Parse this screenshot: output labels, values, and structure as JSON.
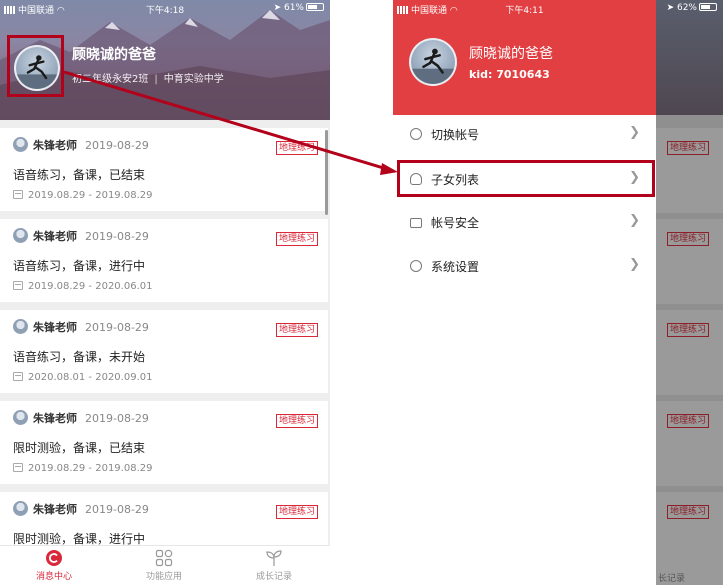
{
  "left": {
    "status": {
      "carrier": "中国联通",
      "time": "下午4:18",
      "battery": "61%"
    },
    "profile": {
      "name": "顾晓诚的爸爸",
      "class": "初二年级永安2班",
      "school": "中育实验中学"
    },
    "cards": [
      {
        "teacher": "朱锋老师",
        "date": "2019-08-29",
        "tag": "地理练习",
        "title": "语音练习，备课，已结束",
        "range": "2019.08.29 - 2019.08.29"
      },
      {
        "teacher": "朱锋老师",
        "date": "2019-08-29",
        "tag": "地理练习",
        "title": "语音练习，备课，进行中",
        "range": "2019.08.29 - 2020.06.01"
      },
      {
        "teacher": "朱锋老师",
        "date": "2019-08-29",
        "tag": "地理练习",
        "title": "语音练习，备课，未开始",
        "range": "2020.08.01 - 2020.09.01"
      },
      {
        "teacher": "朱锋老师",
        "date": "2019-08-29",
        "tag": "地理练习",
        "title": "限时测验，备课，已结束",
        "range": "2019.08.29 - 2019.08.29"
      },
      {
        "teacher": "朱锋老师",
        "date": "2019-08-29",
        "tag": "地理练习",
        "title": "限时测验，备课，进行中",
        "range": ""
      }
    ],
    "tabs": {
      "messages": "消息中心",
      "functions": "功能应用",
      "growth": "成长记录"
    }
  },
  "right": {
    "status": {
      "carrier": "中国联通",
      "time": "下午4:11",
      "battery": "62%"
    },
    "profile": {
      "name": "顾晓诚的爸爸",
      "kid": "kid: 7010643"
    },
    "menu": {
      "switch_account": "切换帐号",
      "children_list": "子女列表",
      "account_security": "帐号安全",
      "system_settings": "系统设置"
    },
    "underlay": {
      "tag": "地理练习",
      "tab": "长记录"
    }
  },
  "colors": {
    "accent": "#e23f42",
    "highlight": "#b3001b",
    "tag": "#d9283a"
  }
}
